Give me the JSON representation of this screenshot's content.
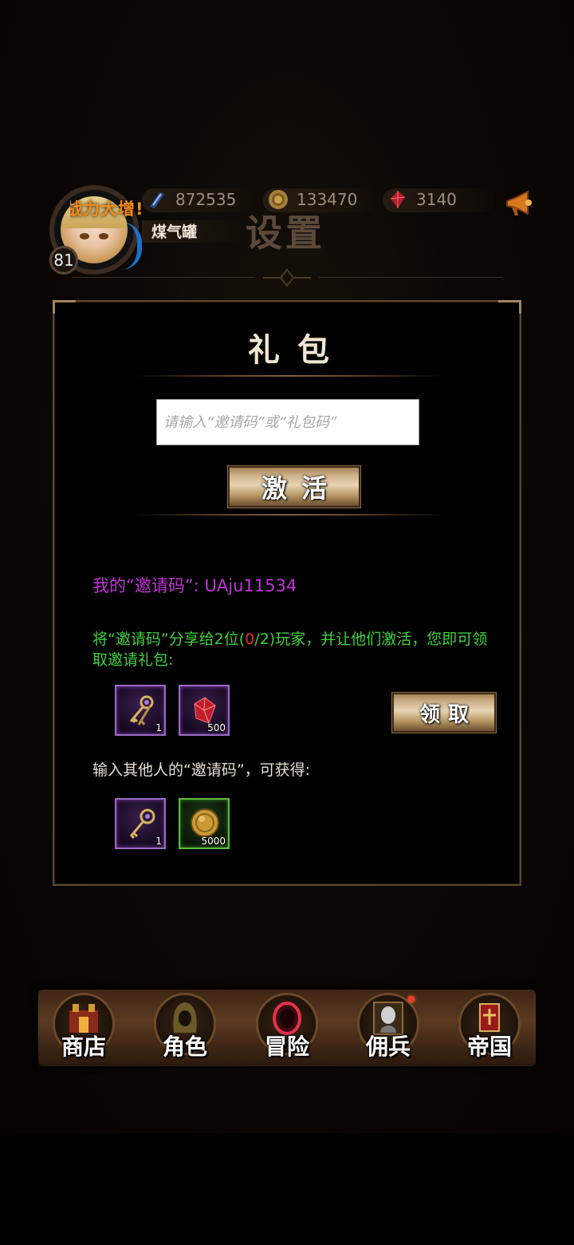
{
  "header": {
    "player_name": "煤气罐",
    "level": "81",
    "power_banner": "战力大增!",
    "page_title": "设置",
    "resources": [
      {
        "icon": "blue-crystal-icon",
        "value": "872535"
      },
      {
        "icon": "gold-coin-icon",
        "value": "133470"
      },
      {
        "icon": "red-gem-icon",
        "value": "3140"
      }
    ],
    "announce_icon": "megaphone-icon"
  },
  "gift_panel": {
    "title": "礼包",
    "code_input_placeholder": "请输入“邀请码”或“礼包码”",
    "activate_label": "激活",
    "my_code_label": "我的“邀请码”: UAju11534",
    "share_text_a": "将“邀请码”分享给2位(",
    "share_progress_current": "0",
    "share_text_b": "/2)玩家，并让他们激活，您即可领取邀请礼包:",
    "claim_label": "领取",
    "invite_rewards": [
      {
        "icon": "keys-icon",
        "count": "1",
        "rarity": "purple"
      },
      {
        "icon": "red-gem-icon",
        "count": "500",
        "rarity": "purple"
      }
    ],
    "other_code_text": "输入其他人的“邀请码”，可获得:",
    "enter_rewards": [
      {
        "icon": "key-icon",
        "count": "1",
        "rarity": "purple"
      },
      {
        "icon": "gold-coin-icon",
        "count": "5000",
        "rarity": "green"
      }
    ]
  },
  "nav": [
    {
      "label": "商店",
      "icon": "shop-icon"
    },
    {
      "label": "角色",
      "icon": "hooded-character-icon"
    },
    {
      "label": "冒险",
      "icon": "portal-icon"
    },
    {
      "label": "佣兵",
      "icon": "mercenary-icon"
    },
    {
      "label": "帝国",
      "icon": "banner-icon"
    }
  ],
  "colors": {
    "invite_code": "#c233d8",
    "share_text": "#3fd03f",
    "progress_highlight": "#e42a2a",
    "gold_button": "#cdb089"
  }
}
